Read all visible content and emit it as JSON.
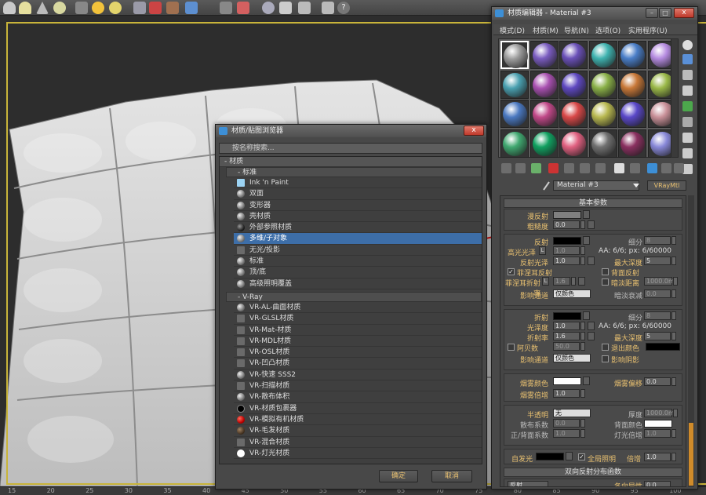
{
  "ruler": {
    "ticks": [
      "15",
      "20",
      "25",
      "30",
      "35",
      "40",
      "45",
      "50",
      "55",
      "60",
      "65",
      "70",
      "75",
      "80",
      "85",
      "90",
      "95",
      "100"
    ]
  },
  "browser": {
    "title": "材质/贴图浏览器",
    "close": "x",
    "search_placeholder": "按名称搜索...",
    "group_materials": "- 材质",
    "subgroup_standard": "- 标准",
    "standard_items": [
      {
        "label": "Ink 'n Paint",
        "icon": "blue"
      },
      {
        "label": "双面",
        "icon": "ball"
      },
      {
        "label": "变形器",
        "icon": "ball"
      },
      {
        "label": "壳材质",
        "icon": "ball"
      },
      {
        "label": "外部参照材质",
        "icon": "dark"
      },
      {
        "label": "多维/子对象",
        "icon": "ball",
        "selected": true
      },
      {
        "label": "无光/投影",
        "icon": "sq"
      },
      {
        "label": "标准",
        "icon": "ball"
      },
      {
        "label": "顶/底",
        "icon": "ball"
      },
      {
        "label": "高级照明覆盖",
        "icon": "ball"
      }
    ],
    "subgroup_vray": "- V-Ray",
    "vray_items": [
      {
        "label": "VR-AL-曲面材质",
        "icon": "ball"
      },
      {
        "label": "VR-GLSL材质",
        "icon": "sq"
      },
      {
        "label": "VR-Mat-材质",
        "icon": "sq"
      },
      {
        "label": "VR-MDL材质",
        "icon": "sq"
      },
      {
        "label": "VR-OSL材质",
        "icon": "sq"
      },
      {
        "label": "VR-凹凸材质",
        "icon": "sq"
      },
      {
        "label": "VR-快速 SSS2",
        "icon": "ball"
      },
      {
        "label": "VR-扫描材质",
        "icon": "sq"
      },
      {
        "label": "VR-散布体积",
        "icon": "ball"
      },
      {
        "label": "VR-材质包裹器",
        "icon": "black"
      },
      {
        "label": "VR-模拟有机材质",
        "icon": "red"
      },
      {
        "label": "VR-毛发材质",
        "icon": "fur"
      },
      {
        "label": "VR-混合材质",
        "icon": "sq"
      },
      {
        "label": "VR-灯光材质",
        "icon": "white"
      }
    ],
    "ok": "确定",
    "cancel": "取消"
  },
  "editor": {
    "title": "材质编辑器 - Material #3",
    "menu": [
      "模式(D)",
      "材质(M)",
      "导航(N)",
      "选项(O)",
      "实用程序(U)"
    ],
    "slot_colors": [
      "#9a9a9a",
      "#7a5cc0",
      "#6a50b8",
      "#3fb3b0",
      "#4a7ec8",
      "#b58be0",
      "#4aa0b0",
      "#a850b0",
      "#5e48c0",
      "#8ab048",
      "#c87838",
      "#9ab848",
      "#4a78c0",
      "#c04888",
      "#d84848",
      "#b8b850",
      "#5a48c8",
      "#c89098",
      "#40a870",
      "#10a060",
      "#e06080",
      "#707070",
      "#8a3060",
      "#8888d8"
    ],
    "material_name": "Material #3",
    "material_type": "VRayMtl",
    "rollout_basic": "基本参数",
    "diffuse": "漫反射",
    "roughness": "粗糙度",
    "roughness_val": "0.0",
    "reflect": "反射",
    "subdiv": "细分",
    "subdiv_val": "8",
    "hilight_gloss": "高光光泽",
    "hilight_val": "1.0",
    "aa_reflect": "AA: 6/6; px: 6/60000",
    "refl_gloss": "反射光泽",
    "refl_gloss_val": "1.0",
    "max_depth": "最大深度",
    "max_depth_val": "5",
    "fresnel": "菲涅耳反射",
    "back_reflect": "背面反射",
    "fresnel_ior": "菲涅耳折射率",
    "fresnel_ior_val": "1.6",
    "dim_distance": "暗淡距离",
    "dim_distance_val": "1000.0mr",
    "affect_channels": "影响通道",
    "color_only": "仅颜色",
    "dim_falloff": "暗淡衰减",
    "dim_falloff_val": "0.0",
    "refract": "折射",
    "refr_subdiv": "细分",
    "refr_subdiv_val": "8",
    "glossiness": "光泽度",
    "glossiness_val": "1.0",
    "aa_refract": "AA: 6/6; px: 6/60000",
    "ior": "折射率",
    "ior_val": "1.6",
    "refr_max_depth": "最大深度",
    "refr_max_depth_val": "5",
    "abbe": "阿贝数",
    "abbe_val": "50.0",
    "exit_color": "退出颜色",
    "affect_channels2": "影响通道",
    "color_only2": "仅颜色",
    "affect_shadows": "影响阴影",
    "fog_color": "烟雾颜色",
    "fog_bias": "烟雾偏移",
    "fog_bias_val": "0.0",
    "fog_mult": "烟雾倍增",
    "fog_mult_val": "1.0",
    "translucency": "半透明",
    "translucency_val": "无",
    "thickness": "厚度",
    "thickness_val": "1000.0m",
    "scatter": "散布系数",
    "scatter_val": "0.0",
    "back_color": "背面颜色",
    "fwd_back": "正/背面系数",
    "fwd_back_val": "1.0",
    "light_mult": "灯光倍增",
    "light_mult_val": "1.0",
    "self_illum": "自发光",
    "gi": "全局照明",
    "self_mult": "倍增",
    "self_mult_val": "1.0",
    "rollout_brdf": "双向反射分布函数",
    "brdf_type": "反射",
    "anisotropy": "各向异性",
    "anisotropy_val": "0.0",
    "L": "L"
  }
}
